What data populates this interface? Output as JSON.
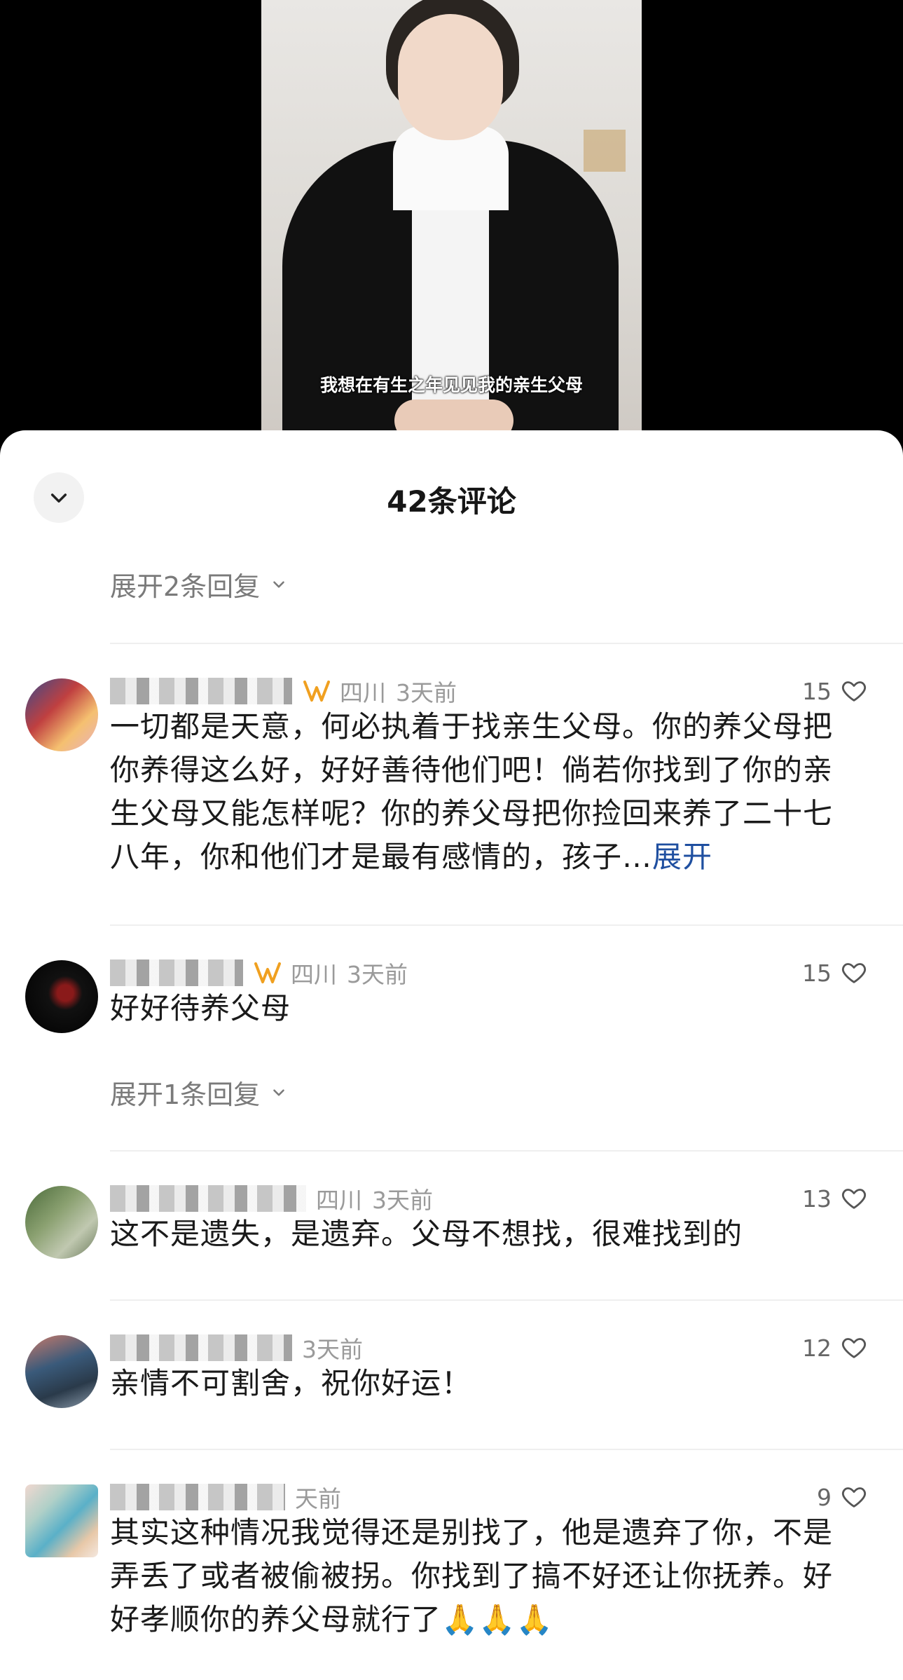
{
  "video": {
    "caption": "我想在有生之年见见我的亲生父母"
  },
  "sheet": {
    "title": "42条评论"
  },
  "expand_top": {
    "label": "展开2条回复"
  },
  "comments": [
    {
      "region": "四川",
      "time": "3天前",
      "likes": "15",
      "text": "一切都是天意，何必执着于找亲生父母。你的养父母把你养得这么好，好好善待他们吧！倘若你找到了你的亲生父母又能怎样呢？你的养父母把你捡回来养了二十七八年，你和他们才是最有感情的，孩子…",
      "more": "展开"
    },
    {
      "region": "四川",
      "time": "3天前",
      "likes": "15",
      "text": "好好待养父母",
      "expand_replies": "展开1条回复"
    },
    {
      "region": "四川",
      "time": "3天前",
      "likes": "13",
      "text": "这不是遗失，是遗弃。父母不想找，很难找到的"
    },
    {
      "time": "3天前",
      "likes": "12",
      "text": "亲情不可割舍，祝你好运！"
    },
    {
      "time": "天前",
      "likes": "9",
      "text": "其实这种情况我觉得还是别找了，他是遗弃了你，不是弄丢了或者被偷被拐。你找到了搞不好还让你抚养。好好孝顺你的养父母就行了🙏🙏🙏"
    }
  ],
  "colors": {
    "accent_link": "#1f4fa0",
    "badge": "#f0a020"
  }
}
